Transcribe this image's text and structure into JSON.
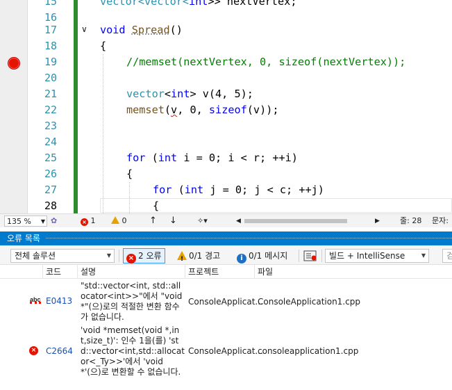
{
  "editor": {
    "line_numbers": [
      "15",
      "16",
      "17",
      "18",
      "19",
      "20",
      "21",
      "22",
      "23",
      "24",
      "25",
      "26",
      "27",
      "28"
    ],
    "current_line": "28",
    "lines": {
      "l15_a": "vector<vector<",
      "l15_b": "int",
      "l15_c": ">> nextVertex;",
      "l16": "",
      "l17_kw": "void",
      "l17_fn": "Spread",
      "l17_rest": "()",
      "l18": "{",
      "l19": "//memset(nextVertex, 0, sizeof(nextVertex));",
      "l21_ty": "vector",
      "l21_a": "<",
      "l21_kw": "int",
      "l21_b": "> v(4, 5);",
      "l22_fn": "memset",
      "l22_a": "(",
      "l22_v": "v",
      "l22_b": ", 0, ",
      "l22_kw": "sizeof",
      "l22_c": "(v));",
      "l25_kw": "for",
      "l25_a": " (",
      "l25_kw2": "int",
      "l25_b": " i = 0; i < r; ++i)",
      "l26": "{",
      "l27_kw": "for",
      "l27_a": " (",
      "l27_kw2": "int",
      "l27_b": " j = 0; j < c; ++j)",
      "l28": "{"
    }
  },
  "editor_status": {
    "zoom": "135 %",
    "errors": "1",
    "warnings": "0",
    "line_label": "줄: 28",
    "col_label": "문자:"
  },
  "error_list": {
    "title": "오류 목록",
    "scope": "전체 솔루션",
    "errors_filter": "2 오류",
    "warnings_filter": "0/1 경고",
    "messages_filter": "0/1 메시지",
    "build_source": "빌드 + IntelliSense",
    "search_placeholder": "검",
    "columns": [
      "코드",
      "설명",
      "프로젝트",
      "파일"
    ],
    "rows": [
      {
        "icon": "intellisense-error-icon",
        "code": "E0413",
        "description": "\"std::vector<int, std::allocator<int>>\"에서 \"void *\"(으)로의 적절한 변환 함수가 없습니다.",
        "project": "ConsoleApplicat...",
        "file": "ConsoleApplication1.cpp"
      },
      {
        "icon": "error-icon",
        "code": "C2664",
        "description": "'void *memset(void *,int,size_t)': 인수 1을(를) 'std::vector<int,std::allocator<_Ty>>'에서 'void *'(으)로 변환할 수 없습니다.",
        "project": "ConsoleApplicat...",
        "file": "consoleapplication1.cpp"
      }
    ]
  },
  "colors": {
    "accent": "#007acc",
    "breakpoint": "#e51400",
    "change_bar": "#2e8b2e",
    "keyword": "#0000ff",
    "type": "#2b91af",
    "comment": "#008000"
  }
}
